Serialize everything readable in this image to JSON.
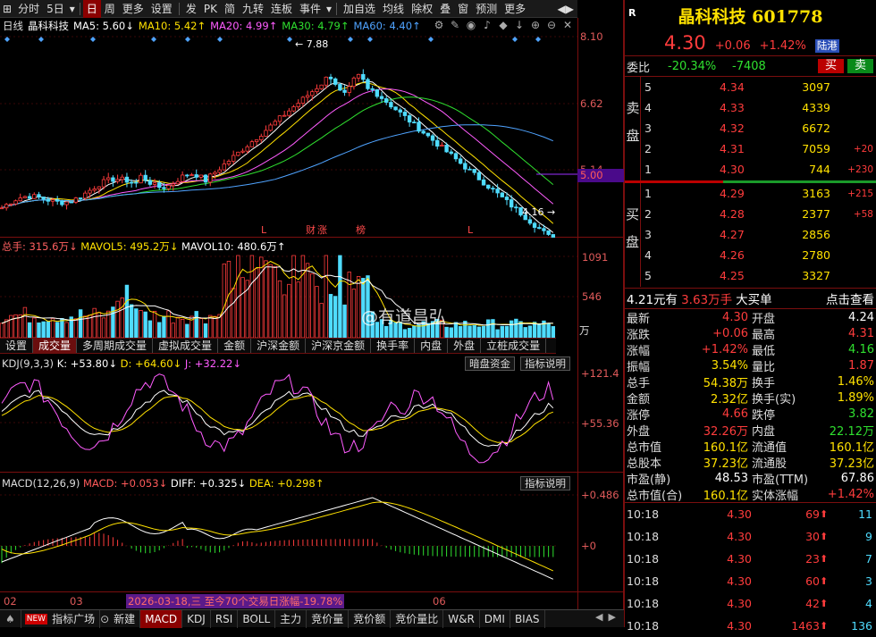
{
  "toolbar": {
    "items": [
      "分时",
      "5日",
      "日",
      "周",
      "更多",
      "设置",
      "发",
      "PK",
      "简",
      "九转",
      "连板",
      "事件",
      "加自选",
      "均线",
      "除权",
      "叠",
      "窗",
      "预测",
      "更多"
    ],
    "active": "日"
  },
  "main_chart": {
    "period": "日线",
    "name": "晶科科技",
    "ma5": "MA5: 5.60↓",
    "ma10": "MA10: 5.42↑",
    "ma20": "MA20: 4.99↑",
    "ma30": "MA30: 4.79↑",
    "ma60": "MA60: 4.40↑",
    "high_label": "7.88",
    "low_label": "4.16",
    "axis": [
      "8.10",
      "6.62",
      "5.14",
      "5.00"
    ],
    "markers": [
      "L",
      "财",
      "涨",
      "榜",
      "L"
    ],
    "current_price_line": "5.00"
  },
  "volume": {
    "legend_total": "总手: 315.6万↓",
    "legend_mavol5": "MAVOL5: 495.2万↓",
    "legend_mavol10": "MAVOL10: 480.6万↑",
    "axis": [
      "1091",
      "546",
      "万"
    ]
  },
  "tabs": {
    "items": [
      "设置",
      "成交量",
      "多周期成交量",
      "虚拟成交量",
      "金额",
      "沪深金额",
      "沪深京金额",
      "换手率",
      "内盘",
      "外盘",
      "立桩成交量"
    ],
    "active": "成交量"
  },
  "kdj": {
    "title": "KDJ(9,3,3)",
    "k": "K: +53.80↓",
    "d": "D: +64.60↓",
    "j": "J: +32.22↓",
    "btn_dark": "暗盘资金",
    "btn_help": "指标说明",
    "axis": [
      "+121.4",
      "+55.36"
    ]
  },
  "macd": {
    "title": "MACD(12,26,9)",
    "macd": "MACD: +0.053↓",
    "diff": "DIFF: +0.325↓",
    "dea": "DEA: +0.298↑",
    "btn_help": "指标说明",
    "axis": [
      "+0.486",
      "+0"
    ]
  },
  "xaxis": {
    "labels": [
      "02",
      "03",
      "06"
    ],
    "hover_note": "2026-03-18,三 至今70个交易日涨幅-19.78%"
  },
  "watermark": "@有道昌弘",
  "bottom_bar": {
    "items": [
      "指标广场",
      "新建",
      "MACD",
      "KDJ",
      "RSI",
      "BOLL",
      "主力",
      "竞价量",
      "竞价额",
      "竞价量比",
      "W&R",
      "DMI",
      "BIAS"
    ],
    "active": "MACD",
    "new_badge": "NEW"
  },
  "stock": {
    "flag": "R",
    "title": "晶科科技 601778",
    "price": "4.30",
    "change": "+0.06",
    "pct": "+1.42%",
    "tag": "陆港"
  },
  "weibi": {
    "label": "委比",
    "ratio": "-20.34%",
    "diff": "-7408",
    "buy_btn": "买",
    "sell_btn": "卖"
  },
  "sell_book": {
    "label": "卖盘",
    "rows": [
      {
        "lvl": "5",
        "price": "4.34",
        "vol": "3097",
        "chg": ""
      },
      {
        "lvl": "4",
        "price": "4.33",
        "vol": "4339",
        "chg": ""
      },
      {
        "lvl": "3",
        "price": "4.32",
        "vol": "6672",
        "chg": ""
      },
      {
        "lvl": "2",
        "price": "4.31",
        "vol": "7059",
        "chg": "+20"
      },
      {
        "lvl": "1",
        "price": "4.30",
        "vol": "744",
        "chg": "+230"
      }
    ]
  },
  "buy_book": {
    "label": "买盘",
    "rows": [
      {
        "lvl": "1",
        "price": "4.29",
        "vol": "3163",
        "chg": "+215"
      },
      {
        "lvl": "2",
        "price": "4.28",
        "vol": "2377",
        "chg": "+58"
      },
      {
        "lvl": "3",
        "price": "4.27",
        "vol": "2856",
        "chg": ""
      },
      {
        "lvl": "4",
        "price": "4.26",
        "vol": "2780",
        "chg": ""
      },
      {
        "lvl": "5",
        "price": "4.25",
        "vol": "3327",
        "chg": ""
      }
    ]
  },
  "big_buy": {
    "price_label": "4.21元有",
    "amount": "3.63万手",
    "suffix": "大买单",
    "link": "点击查看"
  },
  "quote": [
    {
      "l1": "最新",
      "v1": "4.30",
      "c1": "red",
      "l2": "开盘",
      "v2": "4.24",
      "c2": "wht"
    },
    {
      "l1": "涨跌",
      "v1": "+0.06",
      "c1": "red",
      "l2": "最高",
      "v2": "4.31",
      "c2": "red"
    },
    {
      "l1": "涨幅",
      "v1": "+1.42%",
      "c1": "red",
      "l2": "最低",
      "v2": "4.16",
      "c2": "grn"
    },
    {
      "l1": "振幅",
      "v1": "3.54%",
      "c1": "yel",
      "l2": "量比",
      "v2": "1.87",
      "c2": "red"
    },
    {
      "l1": "总手",
      "v1": "54.38万",
      "c1": "yel",
      "l2": "换手",
      "v2": "1.46%",
      "c2": "yel"
    },
    {
      "l1": "金额",
      "v1": "2.32亿",
      "c1": "yel",
      "l2": "换手(实)",
      "v2": "1.89%",
      "c2": "yel"
    },
    {
      "l1": "涨停",
      "v1": "4.66",
      "c1": "red",
      "l2": "跌停",
      "v2": "3.82",
      "c2": "grn"
    },
    {
      "l1": "外盘",
      "v1": "32.26万",
      "c1": "red",
      "l2": "内盘",
      "v2": "22.12万",
      "c2": "grn"
    },
    {
      "l1": "总市值",
      "v1": "160.1亿",
      "c1": "yel",
      "l2": "流通值",
      "v2": "160.1亿",
      "c2": "yel"
    },
    {
      "l1": "总股本",
      "v1": "37.23亿",
      "c1": "yel",
      "l2": "流通股",
      "v2": "37.23亿",
      "c2": "yel"
    },
    {
      "l1": "市盈(静)",
      "v1": "48.53",
      "c1": "wht",
      "l2": "市盈(TTM)",
      "v2": "67.86",
      "c2": "wht"
    },
    {
      "l1": "总市值(合)",
      "v1": "160.1亿",
      "c1": "yel",
      "l2": "实体涨幅",
      "v2": "+1.42%",
      "c2": "red"
    }
  ],
  "ticks": [
    {
      "time": "10:18",
      "price": "4.30",
      "vol": "69",
      "n": "11"
    },
    {
      "time": "10:18",
      "price": "4.30",
      "vol": "30",
      "n": "9"
    },
    {
      "time": "10:18",
      "price": "4.30",
      "vol": "23",
      "n": "7"
    },
    {
      "time": "10:18",
      "price": "4.30",
      "vol": "60",
      "n": "3"
    },
    {
      "time": "10:18",
      "price": "4.30",
      "vol": "42",
      "n": "4"
    },
    {
      "time": "10:18",
      "price": "4.30",
      "vol": "1463",
      "n": "136"
    }
  ]
}
